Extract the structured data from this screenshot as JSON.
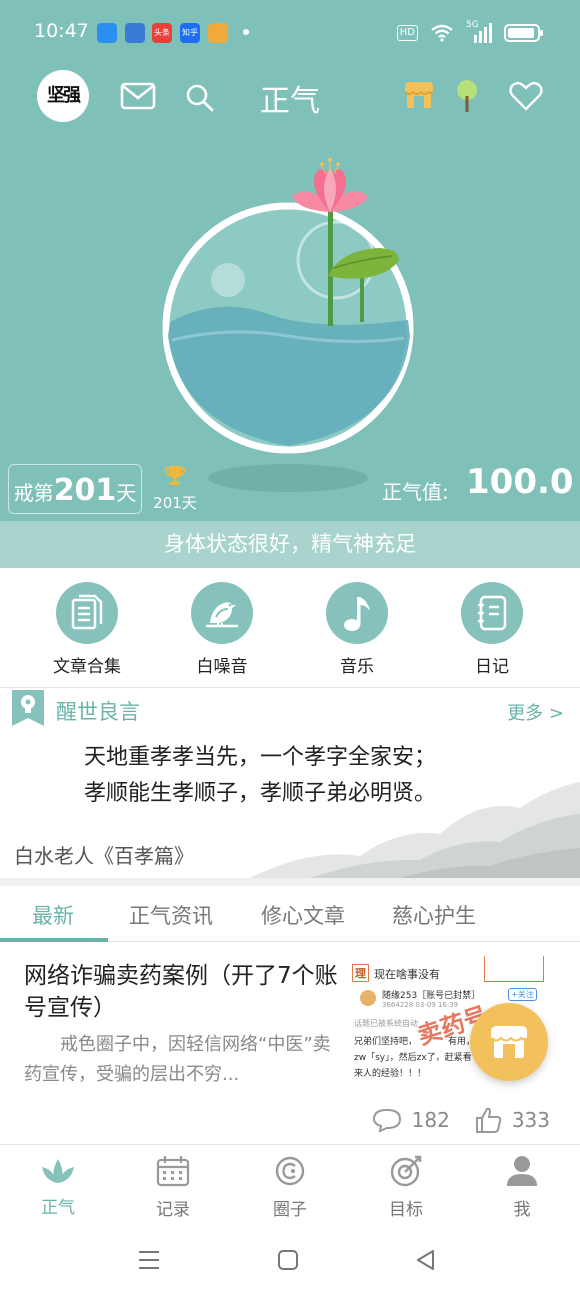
{
  "status_bar": {
    "time": "10:47",
    "notif_apps": [
      {
        "name": "app-icon-blue",
        "text": "",
        "color": "#2c8ef0"
      },
      {
        "name": "app-icon-wave",
        "text": "",
        "color": "#3b7bd8"
      },
      {
        "name": "toutiao-icon",
        "text": "头条",
        "color": "#e8403a"
      },
      {
        "name": "zhihu-icon",
        "text": "知乎",
        "color": "#1d6ff2"
      },
      {
        "name": "wallet-icon",
        "text": "",
        "color": "#f2a93b"
      }
    ],
    "hd": "HD",
    "net": "5G"
  },
  "navbar": {
    "avatar_text": "坚强",
    "title": "正气"
  },
  "hero": {
    "days_prefix": "戒第",
    "days_count": "201",
    "days_suffix": "天",
    "trophy_count": "201天",
    "zhengqi_label": "正气值:",
    "zhengqi_value": "100.0",
    "status_text": "身体状态很好，精气神充足"
  },
  "tools": [
    {
      "label": "文章合集",
      "icon": "document-icon"
    },
    {
      "label": "白噪音",
      "icon": "bird-icon"
    },
    {
      "label": "音乐",
      "icon": "music-note-icon"
    },
    {
      "label": "日记",
      "icon": "notebook-icon"
    }
  ],
  "quote": {
    "section_title": "醒世良言",
    "more_label": "更多 >",
    "line1": "天地重孝孝当先，一个孝字全家安；",
    "line2": "孝顺能生孝顺子，孝顺子弟必明贤。",
    "author": "白水老人《百孝篇》"
  },
  "tabs": [
    "最新",
    "正气资讯",
    "修心文章",
    "慈心护生"
  ],
  "article": {
    "title": "网络诈骗卖药案例（开了7个账号宣传）",
    "summary": "戒色圈子中，因轻信网络“中医”卖药宣传，受骗的层出不穷...",
    "thumb": {
      "header_tag": "理",
      "header_text": "现在啥事没有",
      "user": "随缘253［账号已封禁］",
      "meta": "3664228 03-09 16:39",
      "follow": "+关注",
      "note": "话题已被系统自动",
      "body1": "兄弟们坚持吧，",
      "body1b": "有用，还",
      "body2": "zw「sy」，然后zx了，赶紧看",
      "body3": "来人的经验！！！",
      "stamp": "卖药号"
    },
    "comments": "182",
    "likes": "333"
  },
  "bottom_nav": [
    {
      "label": "正气",
      "icon": "lotus-icon"
    },
    {
      "label": "记录",
      "icon": "calendar-icon"
    },
    {
      "label": "圈子",
      "icon": "circle-icon"
    },
    {
      "label": "目标",
      "icon": "target-icon"
    },
    {
      "label": "我",
      "icon": "person-icon"
    }
  ],
  "colors": {
    "teal": "#7fc0b8",
    "teal_light": "#a9d4cd",
    "accent": "#6ab3aa",
    "fab": "#f3c15c"
  }
}
